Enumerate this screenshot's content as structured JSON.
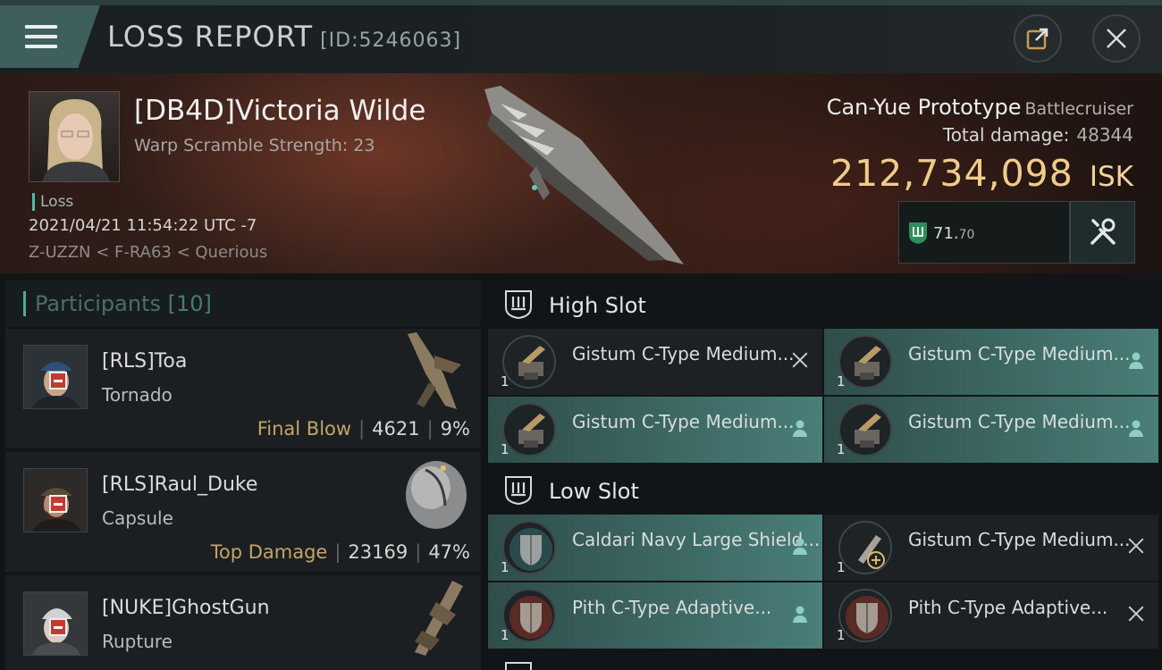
{
  "header": {
    "title": "LOSS REPORT",
    "report_id": "[ID:5246063]",
    "menu_icon": "hamburger-menu-icon",
    "share_icon": "share-external-icon",
    "close_icon": "close-icon"
  },
  "victim": {
    "name": "[DB4D]Victoria Wilde",
    "warp_scramble": "Warp Scramble Strength: 23",
    "status": "Loss",
    "date": "2021/04/21 11:54:22 UTC -7",
    "location": "Z-UZZN < F-RA63 < Querious"
  },
  "ship": {
    "name": "Can-Yue Prototype",
    "class": "Battlecruiser",
    "total_damage_label": "Total damage:",
    "total_damage_value": "48344",
    "isk_value": "212,734,098",
    "isk_unit": "ISK",
    "ehp_main": "71.",
    "ehp_decimal": "70"
  },
  "participants": {
    "label": "Participants",
    "count": "[10]",
    "rows": [
      {
        "name": "[RLS]Toa",
        "ship": "Tornado",
        "tag": "Final Blow",
        "damage": "4621",
        "percent": "9%"
      },
      {
        "name": "[RLS]Raul_Duke",
        "ship": "Capsule",
        "tag": "Top Damage",
        "damage": "23169",
        "percent": "47%"
      },
      {
        "name": "[NUKE]GhostGun",
        "ship": "Rupture",
        "tag": "",
        "damage": "",
        "percent": ""
      }
    ]
  },
  "fitting": {
    "high_slot_label": "High Slot",
    "low_slot_label": "Low Slot",
    "high": [
      {
        "name": "Gistum C-Type Medium...",
        "qty": "1",
        "state": "offline"
      },
      {
        "name": "Gistum C-Type Medium...",
        "qty": "1",
        "state": "active"
      },
      {
        "name": "Gistum C-Type Medium...",
        "qty": "1",
        "state": "active"
      },
      {
        "name": "Gistum C-Type Medium...",
        "qty": "1",
        "state": "active"
      }
    ],
    "low": [
      {
        "name": "Caldari Navy Large Shield...",
        "qty": "1",
        "state": "active"
      },
      {
        "name": "Gistum C-Type Medium...",
        "qty": "1",
        "state": "offline"
      },
      {
        "name": "Pith C-Type Adaptive...",
        "qty": "1",
        "state": "active"
      },
      {
        "name": "Pith C-Type Adaptive...",
        "qty": "1",
        "state": "offline"
      }
    ]
  },
  "colors": {
    "accent": "#58b6a8",
    "isk_gold": "#f0cc8a",
    "module_active": "#3e6a66",
    "final_blow_tag": "#c4a46a"
  }
}
